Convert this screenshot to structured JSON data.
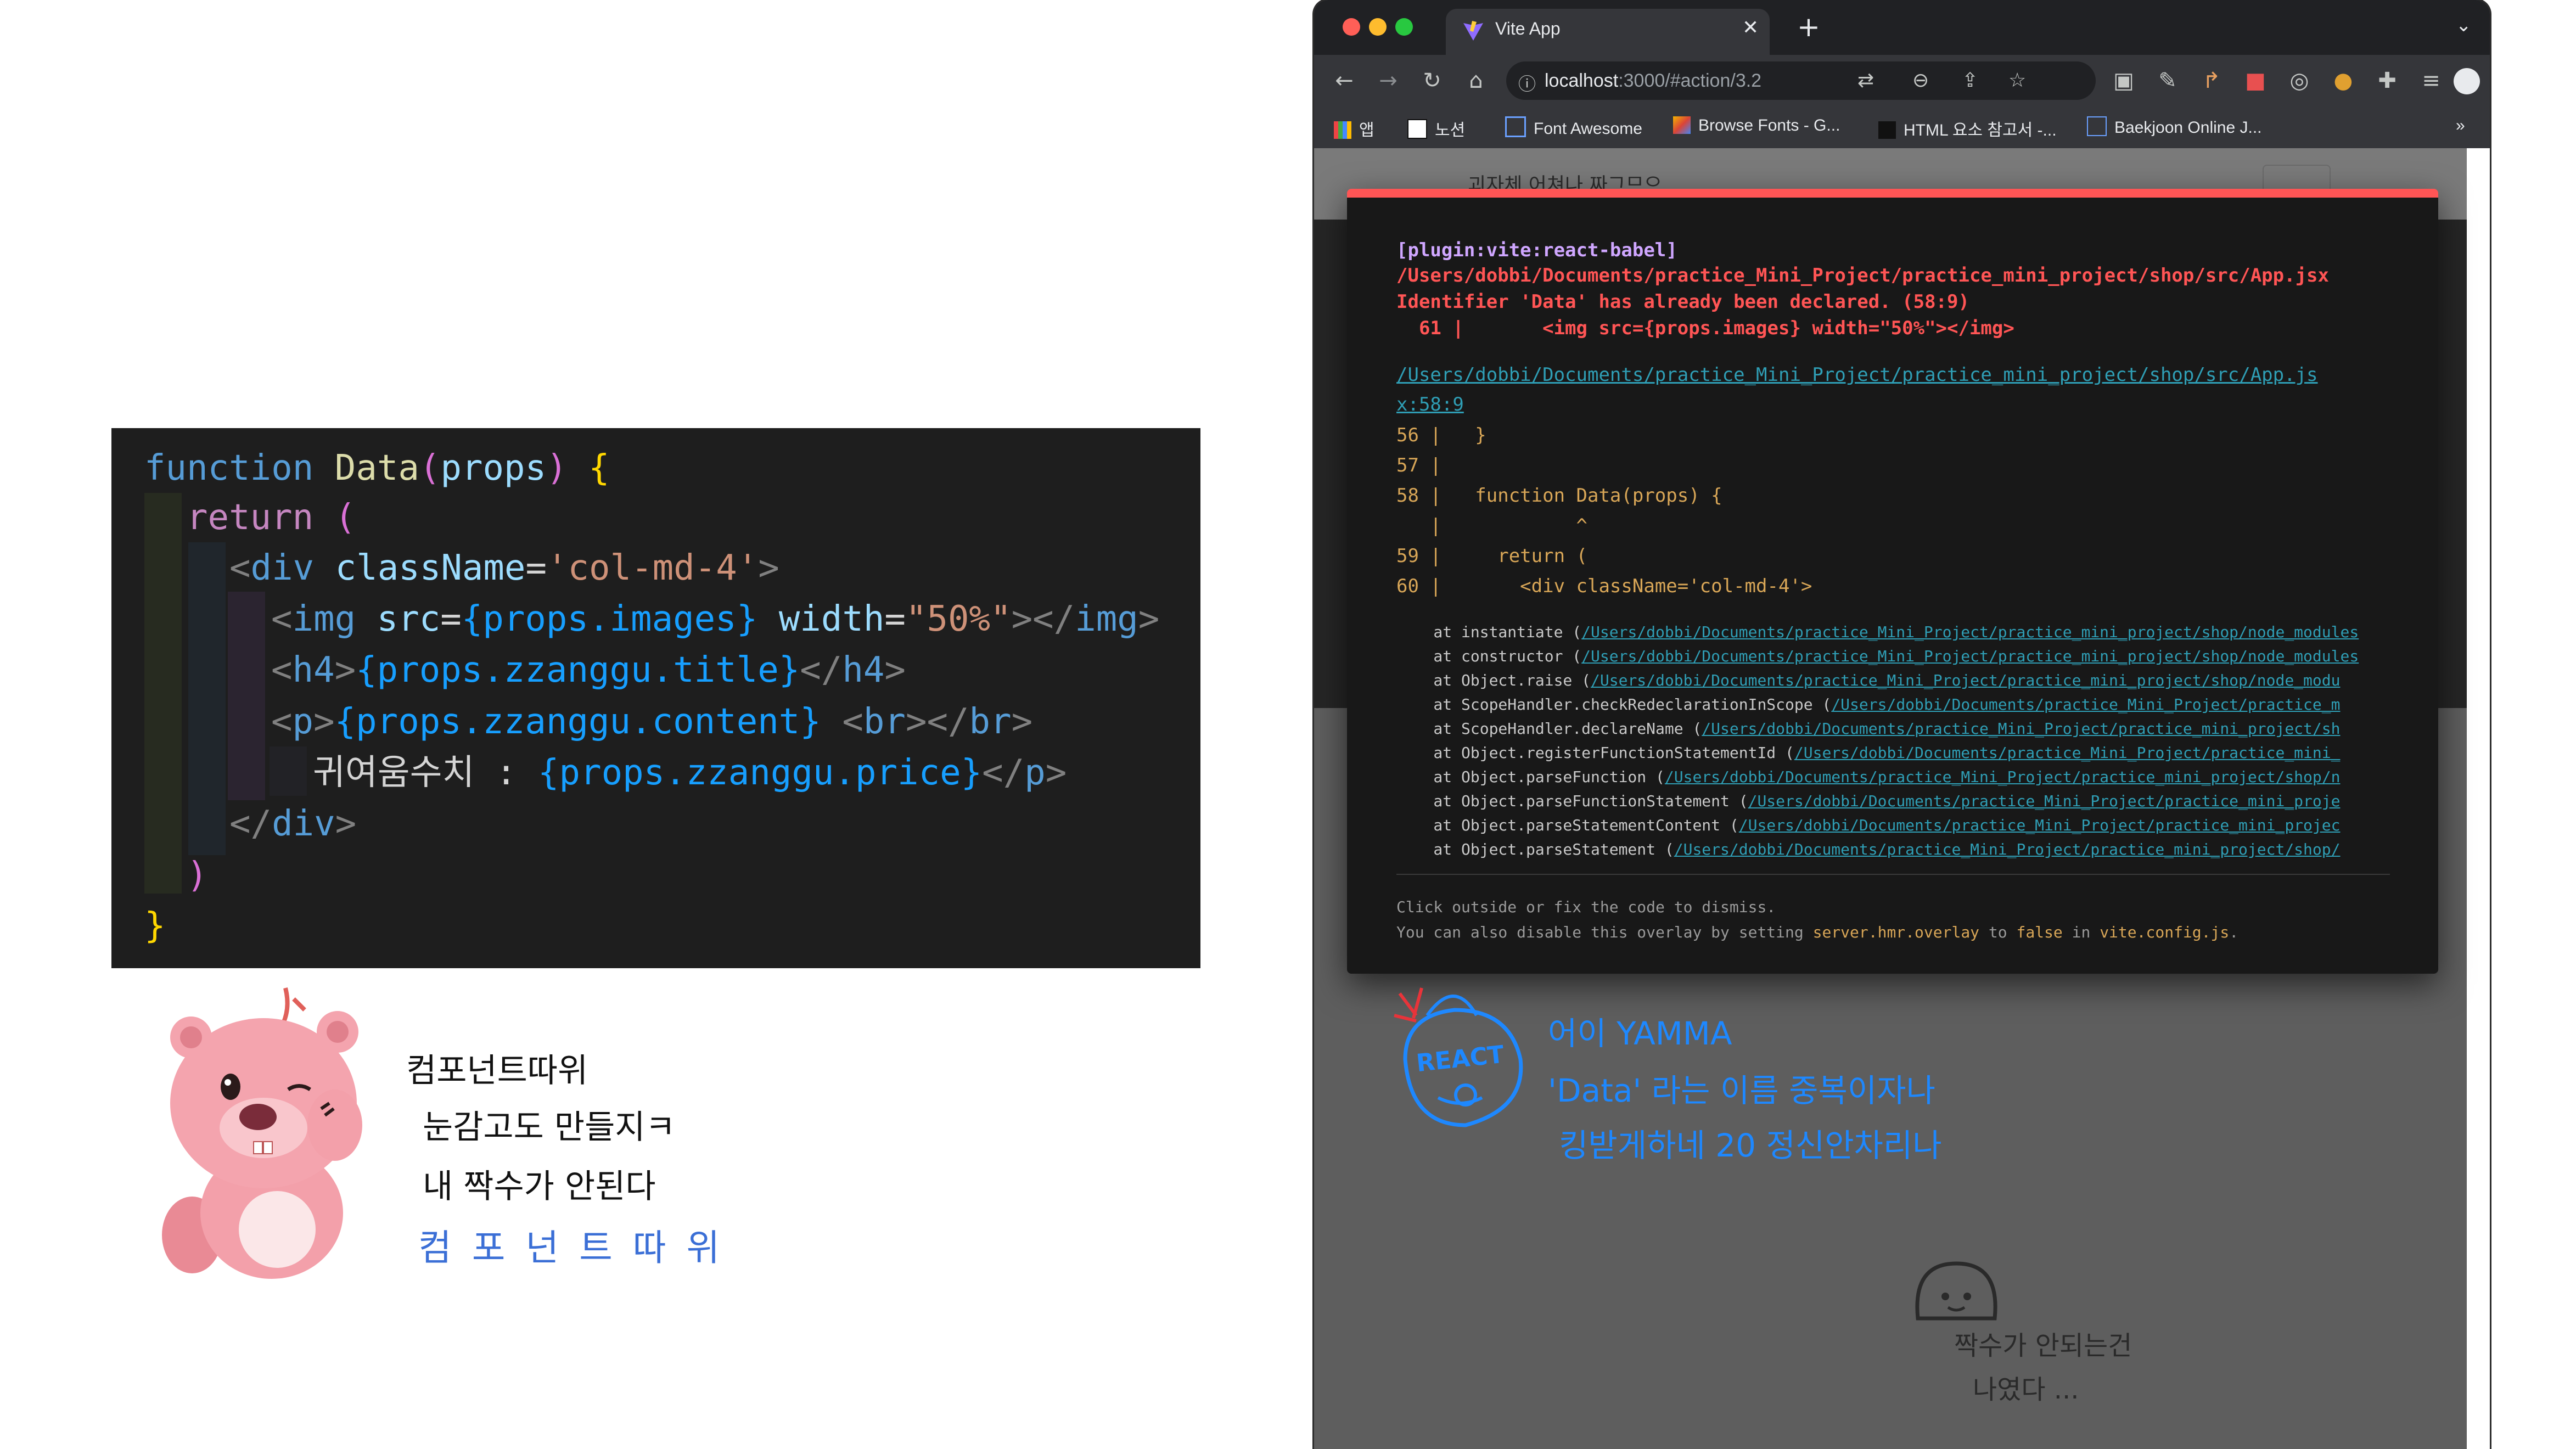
{
  "code": {
    "lines": [
      {
        "ln": "function",
        "fname": "Data",
        "p": "(",
        "arg": "props",
        ")": ")",
        "b": "{"
      },
      {
        "kw": "return",
        "p": "("
      },
      {
        "t1": "<",
        "tag": "div",
        "attr": "className",
        "eq": "=",
        "val": "'col-md-4'",
        "t2": ">"
      },
      {
        "t1": "<",
        "tag": "img",
        "attr1": "src",
        "eq1": "=",
        "expr": "{props.images}",
        "attr2": "width",
        "eq2": "=",
        "val": "\"50%\"",
        "close": "></",
        "tag2": "img",
        "t2": ">"
      },
      {
        "t1": "<",
        "tag": "h4",
        "t2": ">",
        "expr": "{props.zzanggu.title}",
        "c1": "</",
        "tag2": "h4",
        "c2": ">"
      },
      {
        "t1": "<",
        "tag": "p",
        "t2": ">",
        "expr": "{props.zzanggu.content}",
        "sp": " ",
        "b1": "<",
        "tagb": "br",
        "b2": "></",
        "tagb2": "br",
        "b3": ">"
      },
      {
        "text": "귀여움수치 : ",
        "expr": "{props.zzanggu.price}",
        "c1": "</",
        "tag": "p",
        "c2": ">"
      },
      {
        "c1": "</",
        "tag": "div",
        "c2": ">"
      },
      {
        "p": ")"
      },
      {
        "b": "}"
      }
    ]
  },
  "browser": {
    "tab_title": "Vite App",
    "url_host": "localhost",
    "url_path": ":3000/#action/3.2",
    "bookmarks": [
      "앱",
      "노션",
      "Font Awesome",
      "Browse Fonts - G...",
      "HTML 요소 참고서 -...",
      "Baekjoon Online J..."
    ],
    "page_brand": "괴자체 어쳐나 짜그므으"
  },
  "overlay": {
    "plugin": "[plugin:vite:react-babel]",
    "file_path": "/Users/dobbi/Documents/practice_Mini_Project/practice_mini_project/shop/src/App.jsx",
    "message": "Identifier 'Data' has already been declared. (58:9)",
    "snippet": "  61 |       <img src={props.images} width=\"50%\"></img>",
    "link_line1": "/Users/dobbi/Documents/practice_Mini_Project/practice_mini_project/shop/src/App.js",
    "link_line2": "x:58:9",
    "frame": [
      "56 |   }",
      "57 |",
      "58 |   function Data(props) {",
      "   |            ^",
      "59 |     return (",
      "60 |       <div className='col-md-4'>"
    ],
    "stack": [
      {
        "fn": "    at instantiate (",
        "path": "/Users/dobbi/Documents/practice_Mini_Project/practice_mini_project/shop/node_modules"
      },
      {
        "fn": "    at constructor (",
        "path": "/Users/dobbi/Documents/practice_Mini_Project/practice_mini_project/shop/node_modules"
      },
      {
        "fn": "    at Object.raise (",
        "path": "/Users/dobbi/Documents/practice_Mini_Project/practice_mini_project/shop/node_modu"
      },
      {
        "fn": "    at ScopeHandler.checkRedeclarationInScope (",
        "path": "/Users/dobbi/Documents/practice_Mini_Project/practice_m"
      },
      {
        "fn": "    at ScopeHandler.declareName (",
        "path": "/Users/dobbi/Documents/practice_Mini_Project/practice_mini_project/sh"
      },
      {
        "fn": "    at Object.registerFunctionStatementId (",
        "path": "/Users/dobbi/Documents/practice_Mini_Project/practice_mini_"
      },
      {
        "fn": "    at Object.parseFunction (",
        "path": "/Users/dobbi/Documents/practice_Mini_Project/practice_mini_project/shop/n"
      },
      {
        "fn": "    at Object.parseFunctionStatement (",
        "path": "/Users/dobbi/Documents/practice_Mini_Project/practice_mini_proje"
      },
      {
        "fn": "    at Object.parseStatementContent (",
        "path": "/Users/dobbi/Documents/practice_Mini_Project/practice_mini_projec"
      },
      {
        "fn": "    at Object.parseStatement (",
        "path": "/Users/dobbi/Documents/practice_Mini_Project/practice_mini_project/shop/"
      }
    ],
    "tip1": "Click outside or fix the code to dismiss.",
    "tip2_pre": "You can also disable this overlay by setting ",
    "tip2_code": "server.hmr.overlay",
    "tip2_mid": " to ",
    "tip2_false": "false",
    "tip2_in": " in ",
    "tip2_file": "vite.config.js",
    "tip2_end": "."
  },
  "annotations": {
    "react_label": "REACT",
    "react_lines": [
      "어이 YAMMA",
      "'Data' 라는 이름 중복이자나",
      "킹받게하네 20  정신안차리나"
    ],
    "ghost_lines": [
      "짝수가 안되는건",
      "나였다 ..."
    ],
    "loopy_lines": [
      "컴포넌트따위",
      "눈감고도 만들지ㅋ",
      "내 짝수가 안된다"
    ],
    "loopy_blue": "컴 포 넌 트 따 위"
  },
  "colors": {
    "overlay_red": "#ff5555",
    "react_blue": "#1e88ff",
    "loopy_pink": "#f29aa6"
  }
}
